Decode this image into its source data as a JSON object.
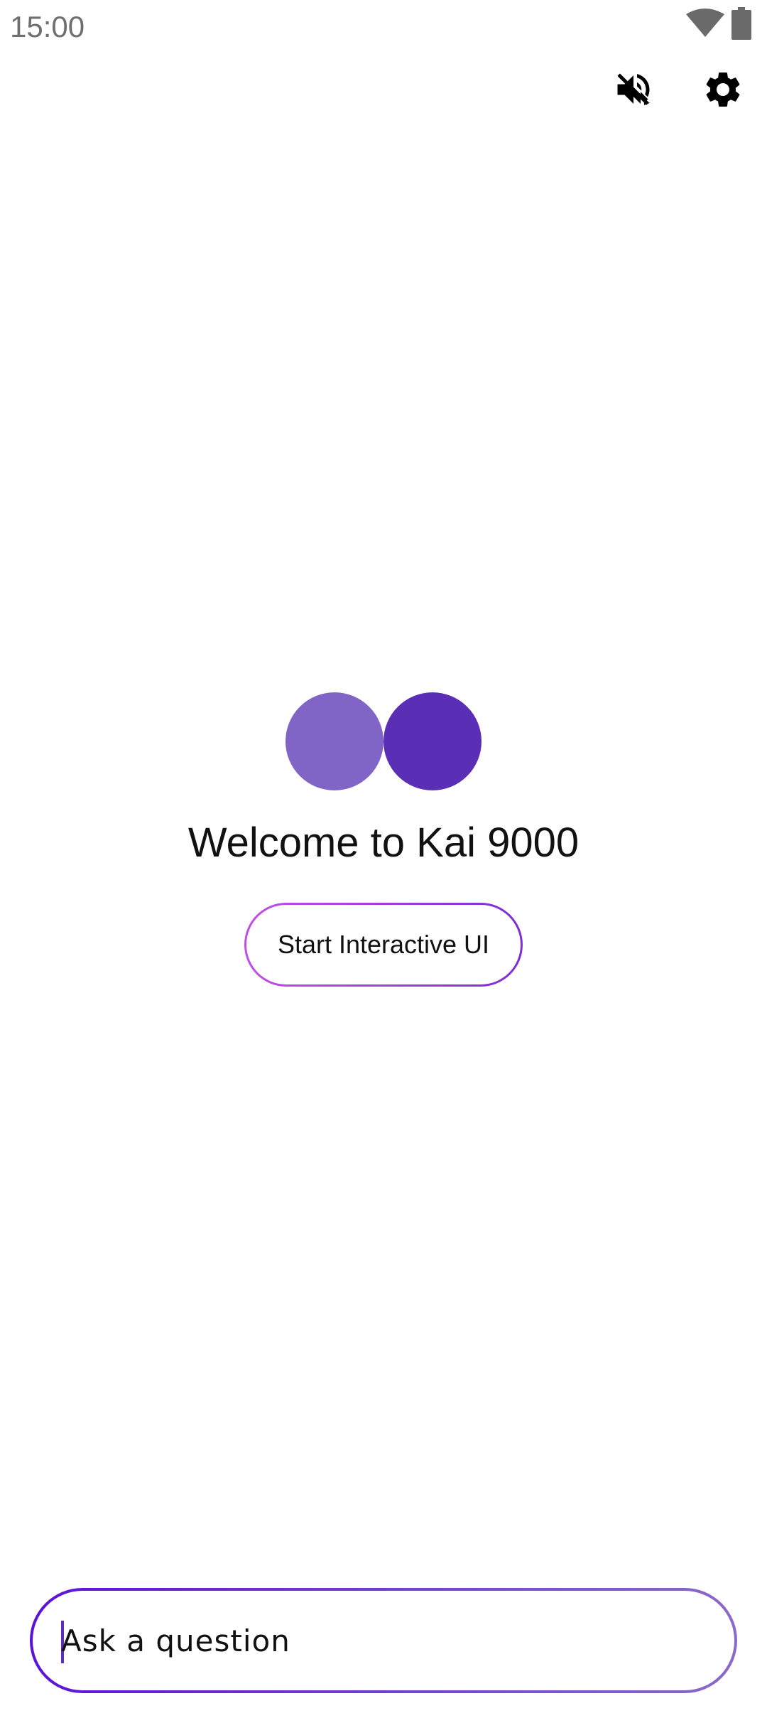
{
  "status_bar": {
    "time": "15:00",
    "wifi_icon": "wifi-icon",
    "battery_icon": "battery-icon"
  },
  "toolbar": {
    "mute_icon": "volume-off-icon",
    "settings_icon": "gear-icon"
  },
  "logo": {
    "left_color": "#8065c6",
    "right_color": "#5a2fb6"
  },
  "welcome": {
    "title": "Welcome to Kai 9000"
  },
  "start_button": {
    "label": "Start Interactive UI",
    "border_gradient": [
      "#c14fe6",
      "#7b2fd6"
    ]
  },
  "question_input": {
    "placeholder": "Ask a question",
    "value": "",
    "border_gradient": [
      "#5a12d9",
      "#8a6ac9"
    ]
  },
  "colors": {
    "accent": "#5a2fb6",
    "background": "#ffffff"
  }
}
